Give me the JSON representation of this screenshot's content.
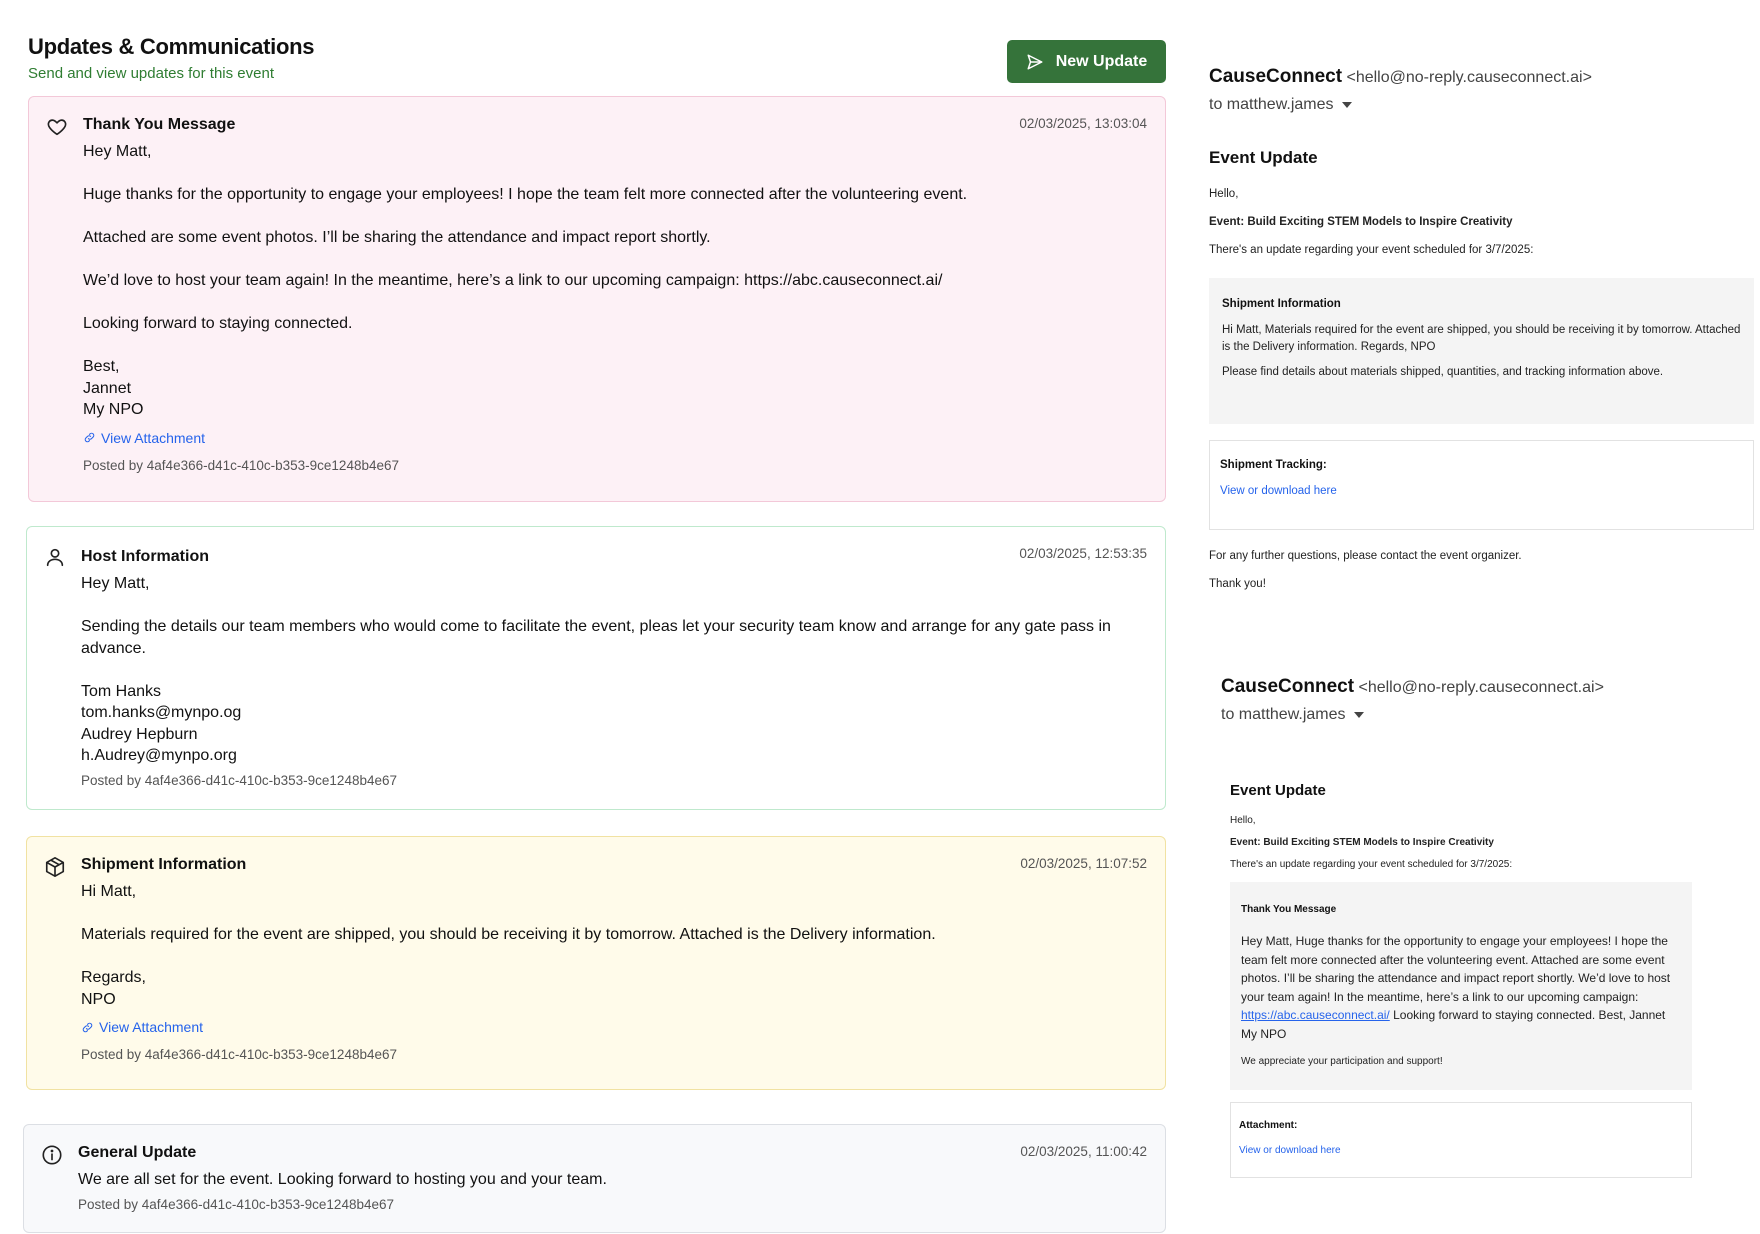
{
  "header": {
    "title": "Updates & Communications",
    "subtitle": "Send and view updates for this event",
    "new_update_label": "New Update"
  },
  "updates": [
    {
      "type": "Thank You Message",
      "icon": "heart-icon",
      "timestamp": "02/03/2025, 13:03:04",
      "body": "Hey Matt,\n\nHuge thanks for the opportunity to engage your employees! I hope the team felt more connected after the volunteering event.\n\nAttached are some event photos. I’ll be sharing the attendance and impact report shortly.\n\nWe’d love to host your team again! In the meantime, here’s a link to our upcoming campaign: https://abc.causeconnect.ai/\n\nLooking forward to staying connected.\n\nBest,\nJannet\nMy NPO",
      "attachment_label": "View Attachment",
      "posted_by": "Posted by 4af4e366-d41c-410c-b353-9ce1248b4e67"
    },
    {
      "type": "Host Information",
      "icon": "user-icon",
      "timestamp": "02/03/2025, 12:53:35",
      "body": "Hey Matt,\n\nSending the details our team members who would come to facilitate the event, pleas let your security team know and arrange for any gate pass in advance.\n\nTom Hanks\ntom.hanks@mynpo.og\nAudrey Hepburn\nh.Audrey@mynpo.org",
      "posted_by": "Posted by 4af4e366-d41c-410c-b353-9ce1248b4e67"
    },
    {
      "type": "Shipment Information",
      "icon": "package-icon",
      "timestamp": "02/03/2025, 11:07:52",
      "body": "Hi Matt,\n\nMaterials required for the event are shipped, you should be receiving it by tomorrow. Attached is the Delivery information.\n\nRegards,\nNPO",
      "attachment_label": "View Attachment",
      "posted_by": "Posted by 4af4e366-d41c-410c-b353-9ce1248b4e67"
    },
    {
      "type": "General Update",
      "icon": "info-icon",
      "timestamp": "02/03/2025, 11:00:42",
      "body": "We are all set for the event. Looking forward to hosting you and your team.",
      "posted_by": "Posted by 4af4e366-d41c-410c-b353-9ce1248b4e67"
    }
  ],
  "emails": [
    {
      "sender": "CauseConnect",
      "sender_email": "<hello@no-reply.causeconnect.ai>",
      "to": "to matthew.james",
      "heading": "Event Update",
      "greeting": "Hello,",
      "event_line": "Event: Build Exciting STEM Models to Inspire Creativity",
      "scheduled_line": "There's an update regarding your event scheduled for 3/7/2025:",
      "box_title": "Shipment Information",
      "box_text": "Hi Matt, Materials required for the event are shipped, you should be receiving it by tomorrow. Attached is the Delivery information. Regards, NPO",
      "box_note": "Please find details about materials shipped, quantities, and tracking information above.",
      "link_box_title": "Shipment Tracking:",
      "link_label": "View or download here",
      "closing": "For any further questions, please contact the event organizer.",
      "thanks": "Thank you!"
    },
    {
      "sender": "CauseConnect",
      "sender_email": "<hello@no-reply.causeconnect.ai>",
      "to": "to matthew.james",
      "heading": "Event Update",
      "greeting": "Hello,",
      "event_line": "Event: Build Exciting STEM Models to Inspire Creativity",
      "scheduled_line": "There's an update regarding your event scheduled for 3/7/2025:",
      "box_title": "Thank You Message",
      "box_text_before": "Hey Matt, Huge thanks for the opportunity to engage your employees! I hope the team felt more connected after the volunteering event. Attached are some event photos. I’ll be sharing the attendance and impact report shortly. We’d love to host your team again! In the meantime, here’s a link to our upcoming campaign: ",
      "box_link": "https://abc.causeconnect.ai/",
      "box_text_after": " Looking forward to staying connected. Best, Jannet My NPO",
      "box_note": "We appreciate your participation and support!",
      "link_box_title": "Attachment:",
      "link_label": "View or download here"
    }
  ]
}
